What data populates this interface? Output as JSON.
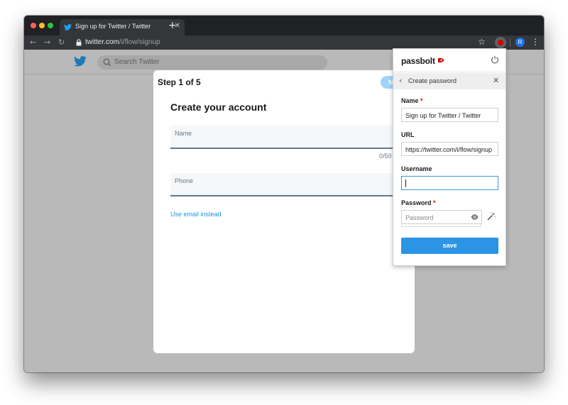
{
  "browser": {
    "tab": {
      "title": "Sign up for Twitter / Twitter",
      "close_glyph": "✕"
    },
    "new_tab_glyph": "+",
    "nav": {
      "back_glyph": "←",
      "forward_glyph": "→",
      "reload_glyph": "↻"
    },
    "url": {
      "host": "twitter.com",
      "path": "/i/flow/signup"
    },
    "star_glyph": "☆",
    "profile_initial": "R",
    "menu_glyph": "⋮"
  },
  "twitter": {
    "search_placeholder": "Search Twitter",
    "modal": {
      "step": "Step 1 of 5",
      "next_button": "N",
      "title": "Create your account",
      "name_label": "Name",
      "name_counter": "0/50",
      "phone_label": "Phone",
      "use_email_link": "Use email instead"
    }
  },
  "passbolt": {
    "logo_text": "passbolt",
    "subheader": {
      "back_glyph": "‹",
      "title": "Create password",
      "close_glyph": "✕"
    },
    "fields": {
      "name": {
        "label": "Name",
        "required_mark": "*",
        "value": "Sign up for Twitter / Twitter"
      },
      "url": {
        "label": "URL",
        "value": "https://twitter.com/i/flow/signup"
      },
      "username": {
        "label": "Username",
        "value": ""
      },
      "password": {
        "label": "Password",
        "required_mark": "*",
        "placeholder": "Password"
      }
    },
    "save_button": "save"
  },
  "colors": {
    "twitter_blue": "#1da1f2",
    "passbolt_red": "#d40101",
    "save_blue": "#2b94e5",
    "overlay_gray": "#b9b9b9"
  },
  "icons": [
    "twitter-bird-icon",
    "search-icon",
    "lock-icon",
    "star-icon",
    "passbolt-extension-icon",
    "power-icon",
    "eye-icon",
    "magic-wand-icon"
  ]
}
